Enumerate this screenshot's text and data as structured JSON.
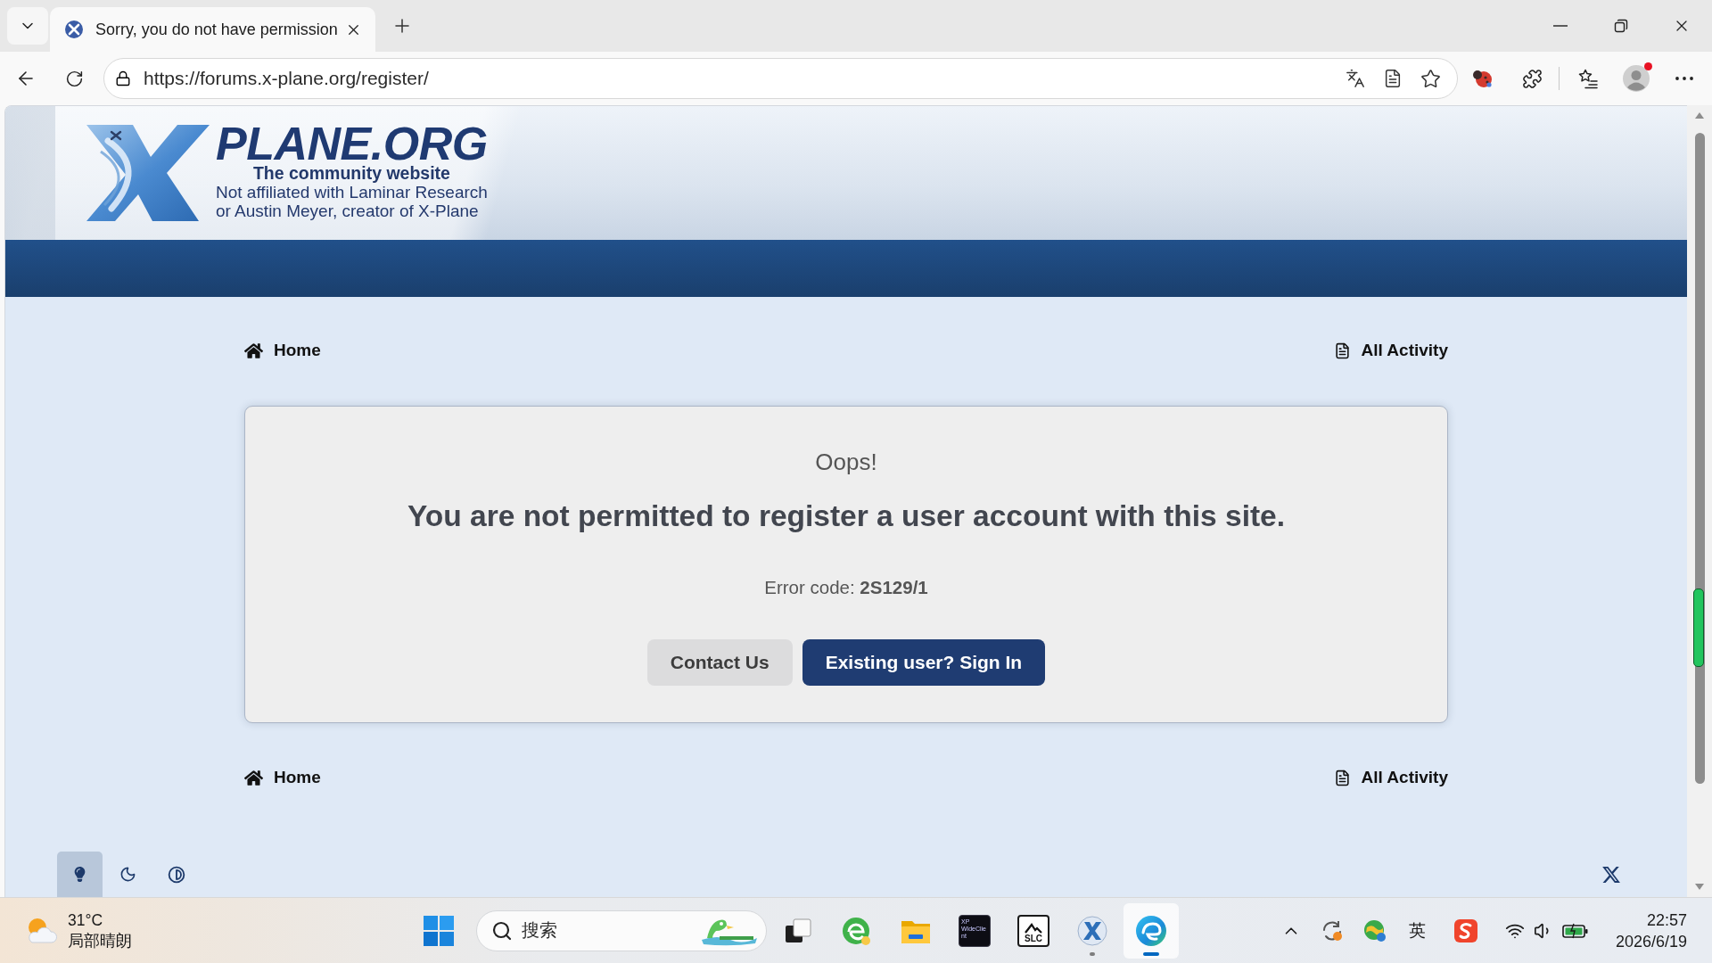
{
  "browser": {
    "tabs": [
      {
        "title": "Sorry, you do not have permission",
        "selected": true
      }
    ],
    "address_bar": {
      "url": "https://forums.x-plane.org/register/"
    },
    "profile": {
      "has_notification": true
    }
  },
  "site_header": {
    "logo": {
      "wordmark": "PLANE.ORG",
      "tagline": "The community website",
      "disclaimer_lines": [
        "Not affiliated with Laminar Research",
        "or Austin Meyer, creator of X-Plane"
      ]
    }
  },
  "breadcrumb_top": [
    {
      "kind": "home",
      "label": "Home"
    },
    {
      "kind": "activity",
      "label": "All Activity"
    }
  ],
  "error_card": {
    "heading": "Oops!",
    "message": "You are not permitted to register a user account with this site.",
    "error_code": "Error code: **2S129/1**",
    "buttons": [
      {
        "kind": "secondary",
        "label": "Contact Us"
      },
      {
        "kind": "primary",
        "label": "Existing user? Sign In"
      }
    ]
  },
  "breadcrumb_bottom": [
    {
      "kind": "home",
      "label": "Home"
    },
    {
      "kind": "activity",
      "label": "All Activity"
    }
  ],
  "footer": {
    "theme_options": [
      {
        "kind": "light",
        "selected": true
      },
      {
        "kind": "dark",
        "selected": false
      },
      {
        "kind": "contrast",
        "selected": false
      }
    ]
  },
  "taskbar": {
    "weather": {
      "temperature": "31°C",
      "condition": "局部晴朗"
    },
    "search": {
      "placeholder": "搜索"
    },
    "apps": [
      {
        "kind": "task-view",
        "running": false,
        "selected": false
      },
      {
        "kind": "edge-ai",
        "running": false,
        "selected": false
      },
      {
        "kind": "file-explorer",
        "running": false,
        "selected": false
      },
      {
        "kind": "wideclient",
        "label": "XP WideClient",
        "running": false,
        "selected": false
      },
      {
        "kind": "slc",
        "label": "SLC",
        "running": false,
        "selected": false
      },
      {
        "kind": "xplane",
        "running": true,
        "selected": false
      },
      {
        "kind": "edge",
        "running": true,
        "selected": true
      }
    ],
    "tray": {
      "input_method": "英"
    },
    "clock": {
      "time": "22:57",
      "date": "2026/6/19"
    }
  }
}
